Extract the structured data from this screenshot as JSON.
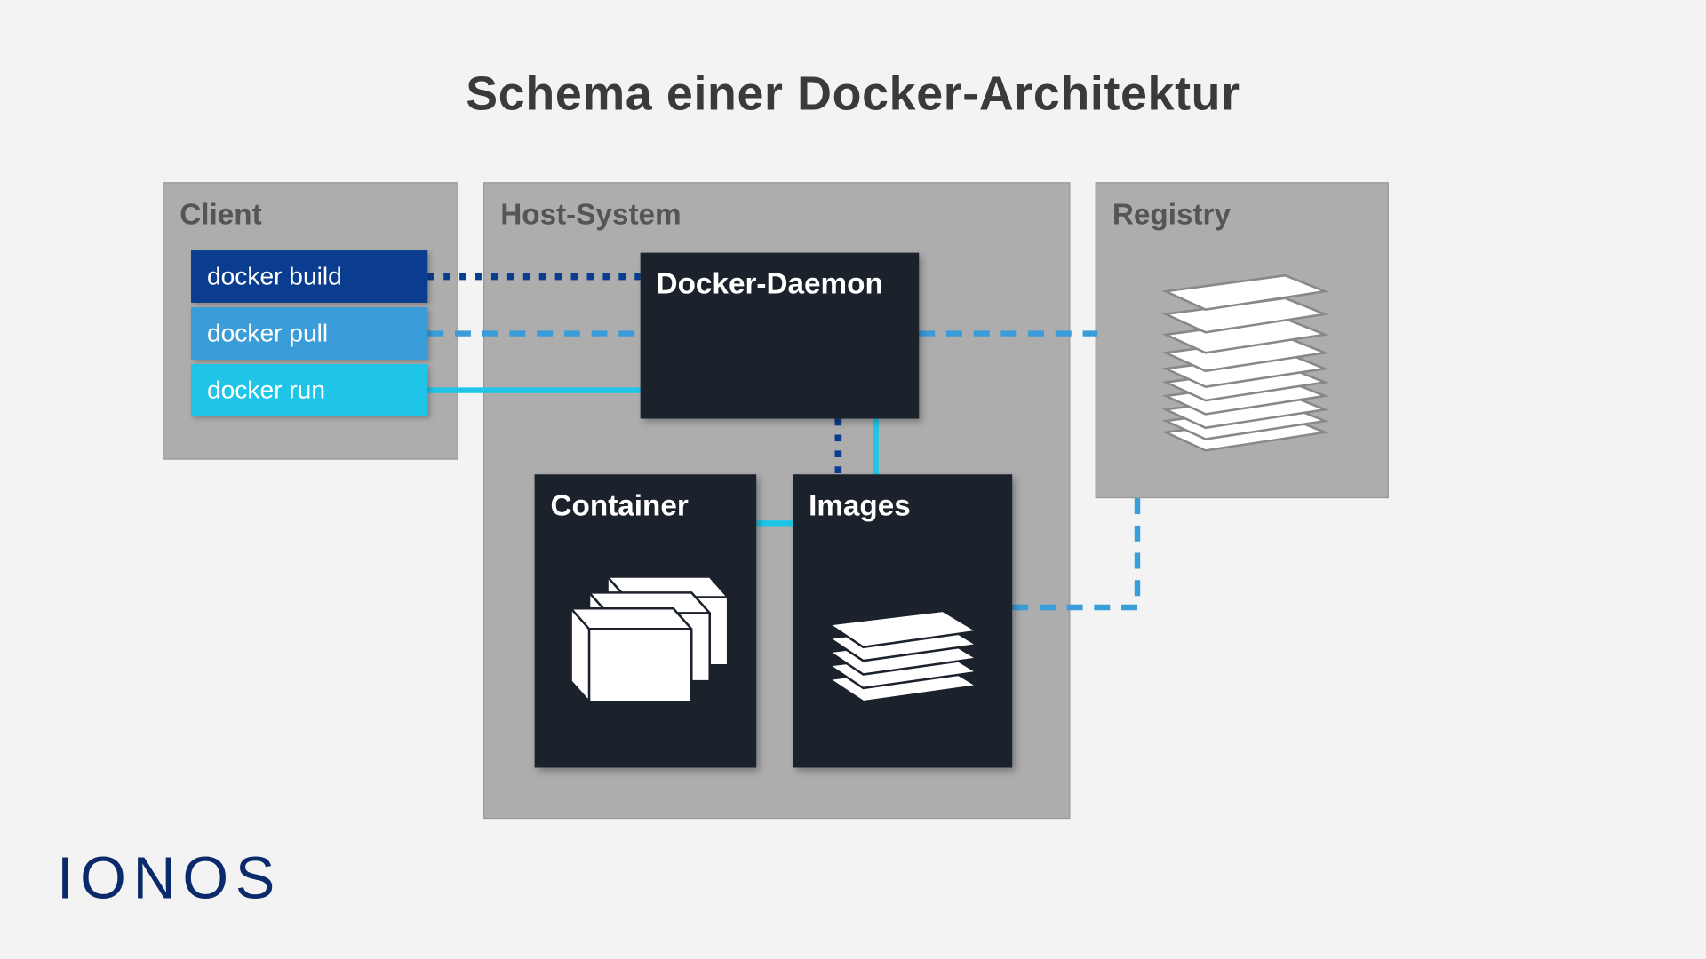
{
  "title": "Schema einer Docker-Architektur",
  "panels": {
    "client": {
      "label": "Client"
    },
    "host": {
      "label": "Host-System"
    },
    "registry": {
      "label": "Registry"
    }
  },
  "commands": {
    "build": {
      "label": "docker build",
      "color": "#0a3d8f"
    },
    "pull": {
      "label": "docker pull",
      "color": "#3a9cd8"
    },
    "run": {
      "label": "docker run",
      "color": "#1fc5e8"
    }
  },
  "boxes": {
    "daemon": {
      "label": "Docker-Daemon"
    },
    "container": {
      "label": "Container"
    },
    "images": {
      "label": "Images"
    }
  },
  "brand": "IONOS",
  "connections": [
    {
      "from": "docker build",
      "to": "Docker-Daemon",
      "style": "dotted",
      "color": "#0a3d8f"
    },
    {
      "from": "docker pull",
      "to": "Docker-Daemon",
      "to2": "Registry",
      "style": "dashed",
      "color": "#3a9cd8"
    },
    {
      "from": "docker run",
      "to": "Docker-Daemon",
      "style": "solid",
      "color": "#1fc5e8"
    },
    {
      "from": "Docker-Daemon",
      "to": "Images",
      "style": "dotted",
      "color": "#0a3d8f"
    },
    {
      "from": "Docker-Daemon",
      "to": "Images",
      "to2": "Container",
      "style": "solid",
      "color": "#1fc5e8"
    },
    {
      "from": "Images",
      "to": "Registry",
      "style": "dashed",
      "color": "#3a9cd8"
    }
  ]
}
